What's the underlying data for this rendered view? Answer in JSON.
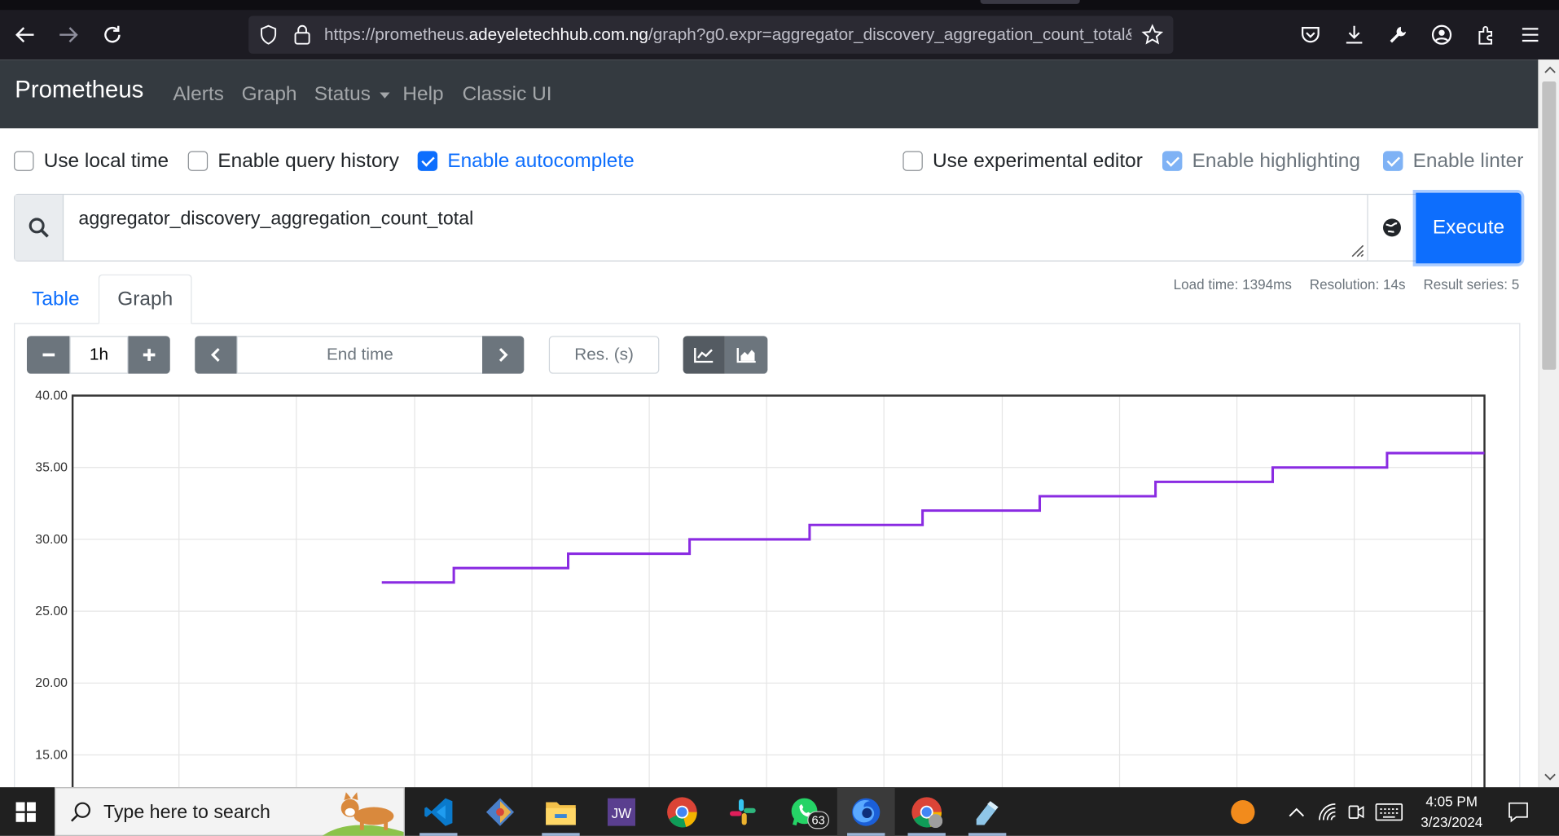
{
  "browser": {
    "url_prefix": "https://prometheus.",
    "url_host": "adeyeletechhub.com.ng",
    "url_rest": "/graph?g0.expr=aggregator_discovery_aggregation_count_total&"
  },
  "navbar": {
    "brand": "Prometheus",
    "links": [
      "Alerts",
      "Graph",
      "Status",
      "Help",
      "Classic UI"
    ]
  },
  "options": {
    "use_local_time": {
      "label": "Use local time",
      "checked": false
    },
    "enable_query_history": {
      "label": "Enable query history",
      "checked": false
    },
    "enable_autocomplete": {
      "label": "Enable autocomplete",
      "checked": true
    },
    "use_experimental_editor": {
      "label": "Use experimental editor",
      "checked": false
    },
    "enable_highlighting": {
      "label": "Enable highlighting",
      "checked": true
    },
    "enable_linter": {
      "label": "Enable linter",
      "checked": true
    }
  },
  "query": {
    "expression": "aggregator_discovery_aggregation_count_total",
    "execute_label": "Execute"
  },
  "stats": {
    "load_time": "Load time: 1394ms",
    "resolution": "Resolution: 14s",
    "result_series": "Result series: 5"
  },
  "tabs": {
    "table": "Table",
    "graph": "Graph"
  },
  "graph_controls": {
    "range": "1h",
    "end_time_placeholder": "End time",
    "resolution_placeholder": "Res. (s)"
  },
  "chart_data": {
    "type": "line",
    "y_ticks": [
      "40.00",
      "35.00",
      "30.00",
      "25.00",
      "20.00",
      "15.00"
    ],
    "ylim": [
      13,
      40
    ],
    "series": [
      {
        "color": "#8a2be2",
        "step": true,
        "x": [
          0.219,
          0.27,
          0.351,
          0.437,
          0.522,
          0.602,
          0.685,
          0.767,
          0.85,
          0.931,
          1.0
        ],
        "values": [
          27,
          28,
          29,
          30,
          31,
          32,
          33,
          34,
          35,
          36,
          36
        ]
      }
    ]
  },
  "taskbar": {
    "search_placeholder": "Type here to search",
    "whatsapp_badge": "63",
    "time": "4:05 PM",
    "date": "3/23/2024"
  }
}
